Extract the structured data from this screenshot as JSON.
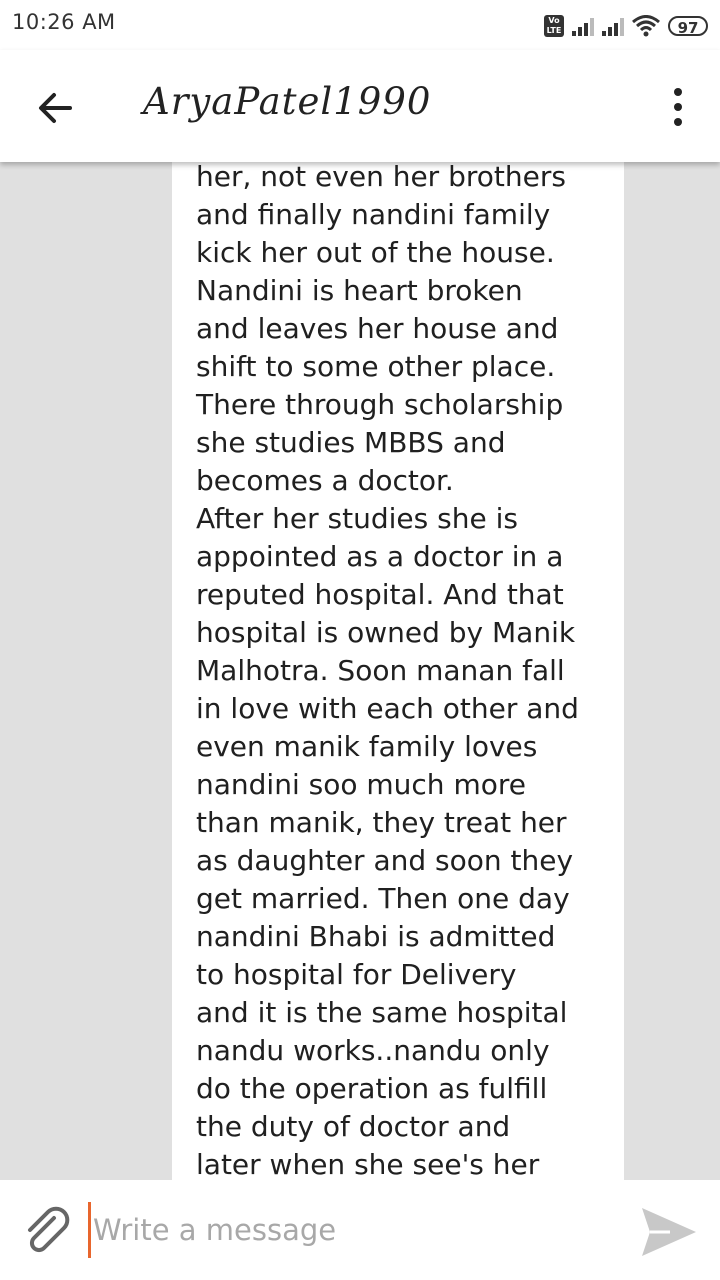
{
  "status_bar": {
    "time": "10:26 AM",
    "volte_top": "Vo",
    "volte_bottom": "LTE",
    "battery": "97",
    "icons": [
      "volte-icon",
      "signal-icon",
      "signal-icon",
      "wifi-icon",
      "battery-icon"
    ]
  },
  "header": {
    "title": "AryaPatel1990",
    "back_icon": "arrow-left-icon",
    "menu_icon": "more-vertical-icon"
  },
  "message": {
    "text": "her, not even her brothers\nand finally nandini family\nkick her out of the house.\nNandini is heart broken\nand leaves her house and\nshift to some other place.\nThere through scholarship\nshe studies MBBS and\nbecomes a doctor.\nAfter her studies she is\nappointed as a doctor in a\nreputed hospital. And that\nhospital is owned by Manik\nMalhotra. Soon manan fall\nin love with each other and\neven manik family loves\nnandini soo much more\nthan manik, they treat her\nas daughter and soon they\nget married. Then one day\nnandini Bhabi is admitted\nto hospital for Delivery\nand it is the same hospital\nnandu works..nandu only\ndo the operation as fulfill\nthe duty of doctor and\nlater when she see's her"
  },
  "composer": {
    "placeholder": "Write a message",
    "value": "",
    "attach_icon": "paperclip-icon",
    "send_icon": "send-icon",
    "cursor_color": "#e8662d"
  }
}
